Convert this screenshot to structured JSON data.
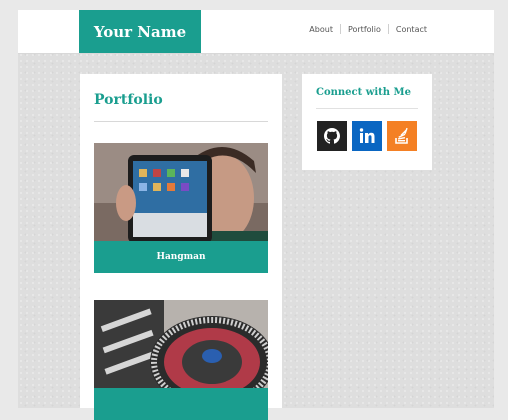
{
  "header": {
    "brand": "Your Name",
    "nav": [
      "About",
      "Portfolio",
      "Contact"
    ]
  },
  "portfolio": {
    "title": "Portfolio",
    "items": [
      {
        "caption": "Hangman",
        "image": "person holding tablet photo"
      },
      {
        "caption": "",
        "image": "turntable / DJ deck photo"
      }
    ]
  },
  "connect": {
    "title": "Connect with Me",
    "icons": [
      "github-icon",
      "linkedin-icon",
      "stackoverflow-icon"
    ]
  },
  "colors": {
    "accent": "#1a9e8f",
    "github": "#222222",
    "linkedin": "#0a66c2",
    "stackoverflow": "#f48024"
  }
}
